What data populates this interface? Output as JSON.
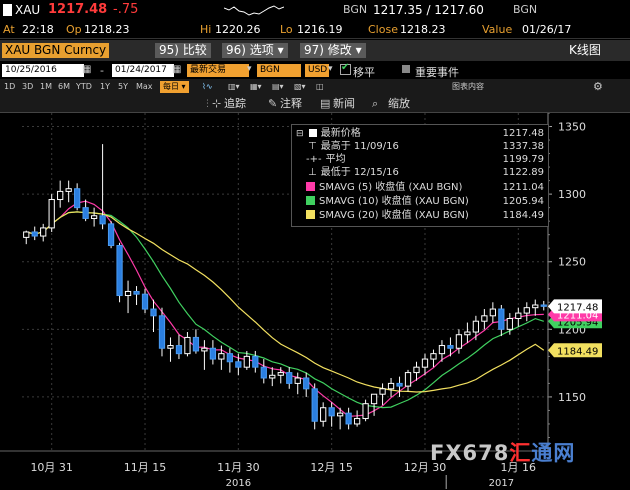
{
  "quote": {
    "ticker": "XAU",
    "last": "1217.48",
    "change": "-.75",
    "hi_label": "Hi",
    "hi": "1220.26",
    "lo_label": "Lo",
    "lo": "1216.19",
    "source": "BGN",
    "bid_ask": "1217.35 / 1217.60",
    "source2": "BGN",
    "at_label": "At",
    "time": "22:18",
    "op_label": "Op",
    "open": "1218.23",
    "close_label": "Close",
    "close": "1218.23",
    "value_label": "Value",
    "value": "01/26/17"
  },
  "menu": {
    "security": "XAU BGN Curncy",
    "compare": "95) 比较",
    "options": "96) 选项 ▾",
    "modify": "97) 修改 ▾",
    "kline": "K线图"
  },
  "controls": {
    "start_date": "10/25/2016",
    "end_date": "01/24/2017",
    "latest_trade": "最新交易",
    "source": "BGN",
    "currency": "USD",
    "move": "移平",
    "events": "重要事件"
  },
  "ranges": [
    "1D",
    "3D",
    "1M",
    "6M",
    "YTD",
    "1Y",
    "5Y",
    "Max",
    "每日 ▾"
  ],
  "right_label": "图表内容",
  "gear_icon": "⚙",
  "tools": {
    "track": "追踪",
    "annotate": "注释",
    "news": "新闻",
    "zoom": "缩放"
  },
  "legend": {
    "latest_label": "最新价格",
    "latest_val": "1217.48",
    "high_label": "最高于 11/09/16",
    "high_val": "1337.38",
    "avg_label": "平均",
    "avg_val": "1199.79",
    "low_label": "最低于 12/15/16",
    "low_val": "1122.89",
    "ma5_label": "SMAVG (5) 收盘值 (XAU BGN)",
    "ma5_val": "1211.04",
    "ma10_label": "SMAVG (10) 收盘值 (XAU BGN)",
    "ma10_val": "1205.94",
    "ma20_label": "SMAVG (20) 收盘值 (XAU BGN)",
    "ma20_val": "1184.49"
  },
  "watermark": {
    "a": "FX678",
    "b": "汇",
    "c": "通网"
  },
  "chart_data": {
    "type": "candlestick",
    "ylim": [
      1110,
      1360
    ],
    "y_ticks": [
      1150,
      1200,
      1250,
      1300,
      1350
    ],
    "x_tick_labels": [
      {
        "label": "10月 31",
        "idx": 3
      },
      {
        "label": "11月 15",
        "idx": 14
      },
      {
        "label": "11月 30",
        "idx": 25
      },
      {
        "label": "12月 15",
        "idx": 36
      },
      {
        "label": "12月 30",
        "idx": 47
      },
      {
        "label": "1月 16",
        "idx": 58
      }
    ],
    "year_labels": [
      {
        "label": "2016",
        "idx": 25
      },
      {
        "label": "2017",
        "idx": 56
      }
    ],
    "year_divider_idx": 49.5,
    "candles": [
      [
        1268,
        1273,
        1263,
        1272
      ],
      [
        1272,
        1276,
        1266,
        1269
      ],
      [
        1269,
        1278,
        1265,
        1275
      ],
      [
        1275,
        1300,
        1272,
        1296
      ],
      [
        1296,
        1310,
        1290,
        1302
      ],
      [
        1302,
        1310,
        1294,
        1304
      ],
      [
        1304,
        1308,
        1288,
        1290
      ],
      [
        1290,
        1296,
        1280,
        1282
      ],
      [
        1282,
        1290,
        1276,
        1284
      ],
      [
        1284,
        1337,
        1274,
        1278
      ],
      [
        1278,
        1280,
        1260,
        1262
      ],
      [
        1262,
        1264,
        1220,
        1225
      ],
      [
        1225,
        1236,
        1212,
        1228
      ],
      [
        1228,
        1232,
        1218,
        1226
      ],
      [
        1226,
        1230,
        1212,
        1215
      ],
      [
        1215,
        1222,
        1198,
        1210
      ],
      [
        1210,
        1216,
        1180,
        1186
      ],
      [
        1186,
        1194,
        1176,
        1188
      ],
      [
        1188,
        1196,
        1178,
        1182
      ],
      [
        1182,
        1198,
        1180,
        1194
      ],
      [
        1194,
        1200,
        1182,
        1184
      ],
      [
        1184,
        1192,
        1170,
        1186
      ],
      [
        1186,
        1192,
        1174,
        1178
      ],
      [
        1178,
        1188,
        1170,
        1182
      ],
      [
        1182,
        1186,
        1168,
        1176
      ],
      [
        1176,
        1182,
        1166,
        1172
      ],
      [
        1172,
        1184,
        1170,
        1180
      ],
      [
        1180,
        1184,
        1168,
        1172
      ],
      [
        1172,
        1178,
        1160,
        1164
      ],
      [
        1164,
        1172,
        1158,
        1166
      ],
      [
        1166,
        1172,
        1160,
        1168
      ],
      [
        1168,
        1172,
        1156,
        1160
      ],
      [
        1160,
        1168,
        1152,
        1164
      ],
      [
        1164,
        1168,
        1150,
        1156
      ],
      [
        1156,
        1160,
        1126,
        1132
      ],
      [
        1132,
        1146,
        1128,
        1142
      ],
      [
        1142,
        1146,
        1128,
        1136
      ],
      [
        1136,
        1142,
        1126,
        1138
      ],
      [
        1138,
        1142,
        1126,
        1130
      ],
      [
        1130,
        1140,
        1128,
        1134
      ],
      [
        1134,
        1148,
        1132,
        1145
      ],
      [
        1145,
        1150,
        1136,
        1152
      ],
      [
        1152,
        1160,
        1144,
        1156
      ],
      [
        1156,
        1164,
        1150,
        1160
      ],
      [
        1160,
        1165,
        1150,
        1158
      ],
      [
        1158,
        1170,
        1154,
        1168
      ],
      [
        1168,
        1176,
        1162,
        1172
      ],
      [
        1172,
        1182,
        1166,
        1178
      ],
      [
        1178,
        1185,
        1172,
        1182
      ],
      [
        1182,
        1192,
        1176,
        1188
      ],
      [
        1188,
        1194,
        1180,
        1186
      ],
      [
        1186,
        1200,
        1182,
        1196
      ],
      [
        1196,
        1205,
        1190,
        1198
      ],
      [
        1198,
        1210,
        1192,
        1206
      ],
      [
        1206,
        1215,
        1200,
        1210
      ],
      [
        1210,
        1220,
        1205,
        1215
      ],
      [
        1215,
        1218,
        1195,
        1200
      ],
      [
        1200,
        1212,
        1196,
        1208
      ],
      [
        1208,
        1216,
        1202,
        1212
      ],
      [
        1212,
        1220,
        1206,
        1216
      ],
      [
        1216,
        1222,
        1210,
        1218
      ],
      [
        1218,
        1221,
        1214,
        1217
      ]
    ],
    "series": [
      {
        "name": "SMAVG (5)",
        "color": "#ff3aa8",
        "last": 1211.04
      },
      {
        "name": "SMAVG (10)",
        "color": "#40d060",
        "last": 1205.94
      },
      {
        "name": "SMAVG (20)",
        "color": "#f2e060",
        "last": 1184.49
      }
    ],
    "last_price_label": "1217.48",
    "ma5_label": "1211.04",
    "ma10_label": "1205.94",
    "ma20_label": "1184.49"
  }
}
